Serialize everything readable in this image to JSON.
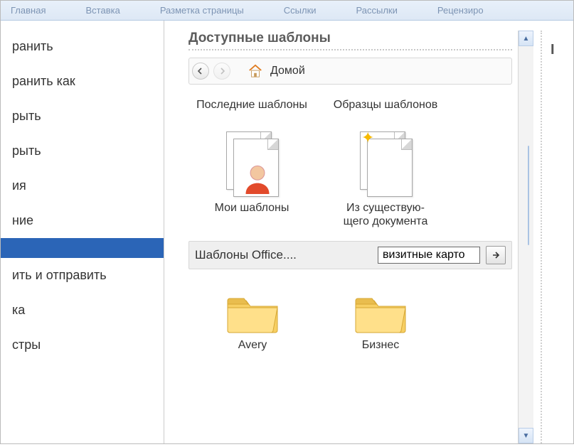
{
  "ribbon": {
    "tabs": [
      "Главная",
      "Вставка",
      "Разметка страницы",
      "Ссылки",
      "Рассылки",
      "Рецензиро"
    ]
  },
  "sidebar": {
    "items": [
      "ранить",
      "ранить как",
      "рыть",
      "рыть",
      "ия",
      "ние",
      "",
      "ить и отправить",
      "ка",
      "стры"
    ],
    "selected_index": 6
  },
  "templates": {
    "title": "Доступные шаблоны",
    "home_label": "Домой",
    "tiles": [
      {
        "caption": "Последние шаблоны",
        "label": "Мои шаблоны"
      },
      {
        "caption": "Образцы шаблонов",
        "label": "Из существую-\nщего документа"
      }
    ],
    "office_label": "Шаблоны Office....",
    "search_value": "визитные карто",
    "folders": [
      {
        "label": "Avery"
      },
      {
        "label": "Бизнес"
      }
    ]
  }
}
